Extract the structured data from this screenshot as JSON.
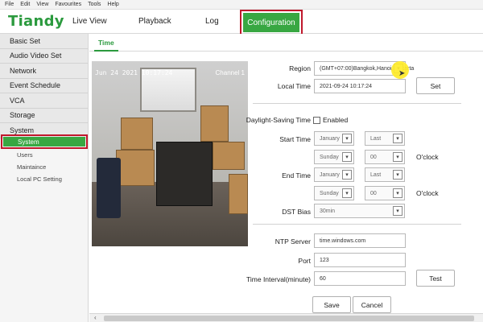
{
  "browser_menu": [
    "File",
    "Edit",
    "View",
    "Favourites",
    "Tools",
    "Help"
  ],
  "app": {
    "logo": "Tiandy",
    "accent_color": "#38a742",
    "highlight_color": "#c0182c"
  },
  "nav": {
    "live_view": "Live View",
    "playback": "Playback",
    "log": "Log",
    "configuration": "Configuration"
  },
  "sidebar": {
    "sections": [
      "Basic Set",
      "Audio Video Set",
      "Network",
      "Event Schedule",
      "VCA",
      "Storage",
      "System"
    ],
    "system_items": [
      "System",
      "Users",
      "Maintaince",
      "Local PC Setting"
    ]
  },
  "tabs": {
    "active": "Time"
  },
  "preview": {
    "osd_time": "Jun 24 2021 10:17:24",
    "osd_channel": "Channel 1"
  },
  "form": {
    "region_label": "Region",
    "region_value": "(GMT+07:00)Bangkok,Hanoi,Djakarta",
    "local_time_label": "Local Time",
    "local_time_value": "2021-09-24 10:17:24",
    "set_label": "Set",
    "dst_label": "Daylight-Saving Time",
    "dst_enabled_label": "Enabled",
    "start_time_label": "Start Time",
    "start_month": "January",
    "start_week": "Last",
    "start_day": "Sunday",
    "start_hour": "00",
    "end_time_label": "End Time",
    "end_month": "January",
    "end_week": "Last",
    "end_day": "Sunday",
    "end_hour": "00",
    "oclock": "O'clock",
    "dst_bias_label": "DST Bias",
    "dst_bias_value": "30min",
    "ntp_server_label": "NTP Server",
    "ntp_server_value": "time.windows.com",
    "port_label": "Port",
    "port_value": "123",
    "interval_label": "Time Interval(minute)",
    "interval_value": "60",
    "test_label": "Test",
    "save_label": "Save",
    "cancel_label": "Cancel"
  }
}
